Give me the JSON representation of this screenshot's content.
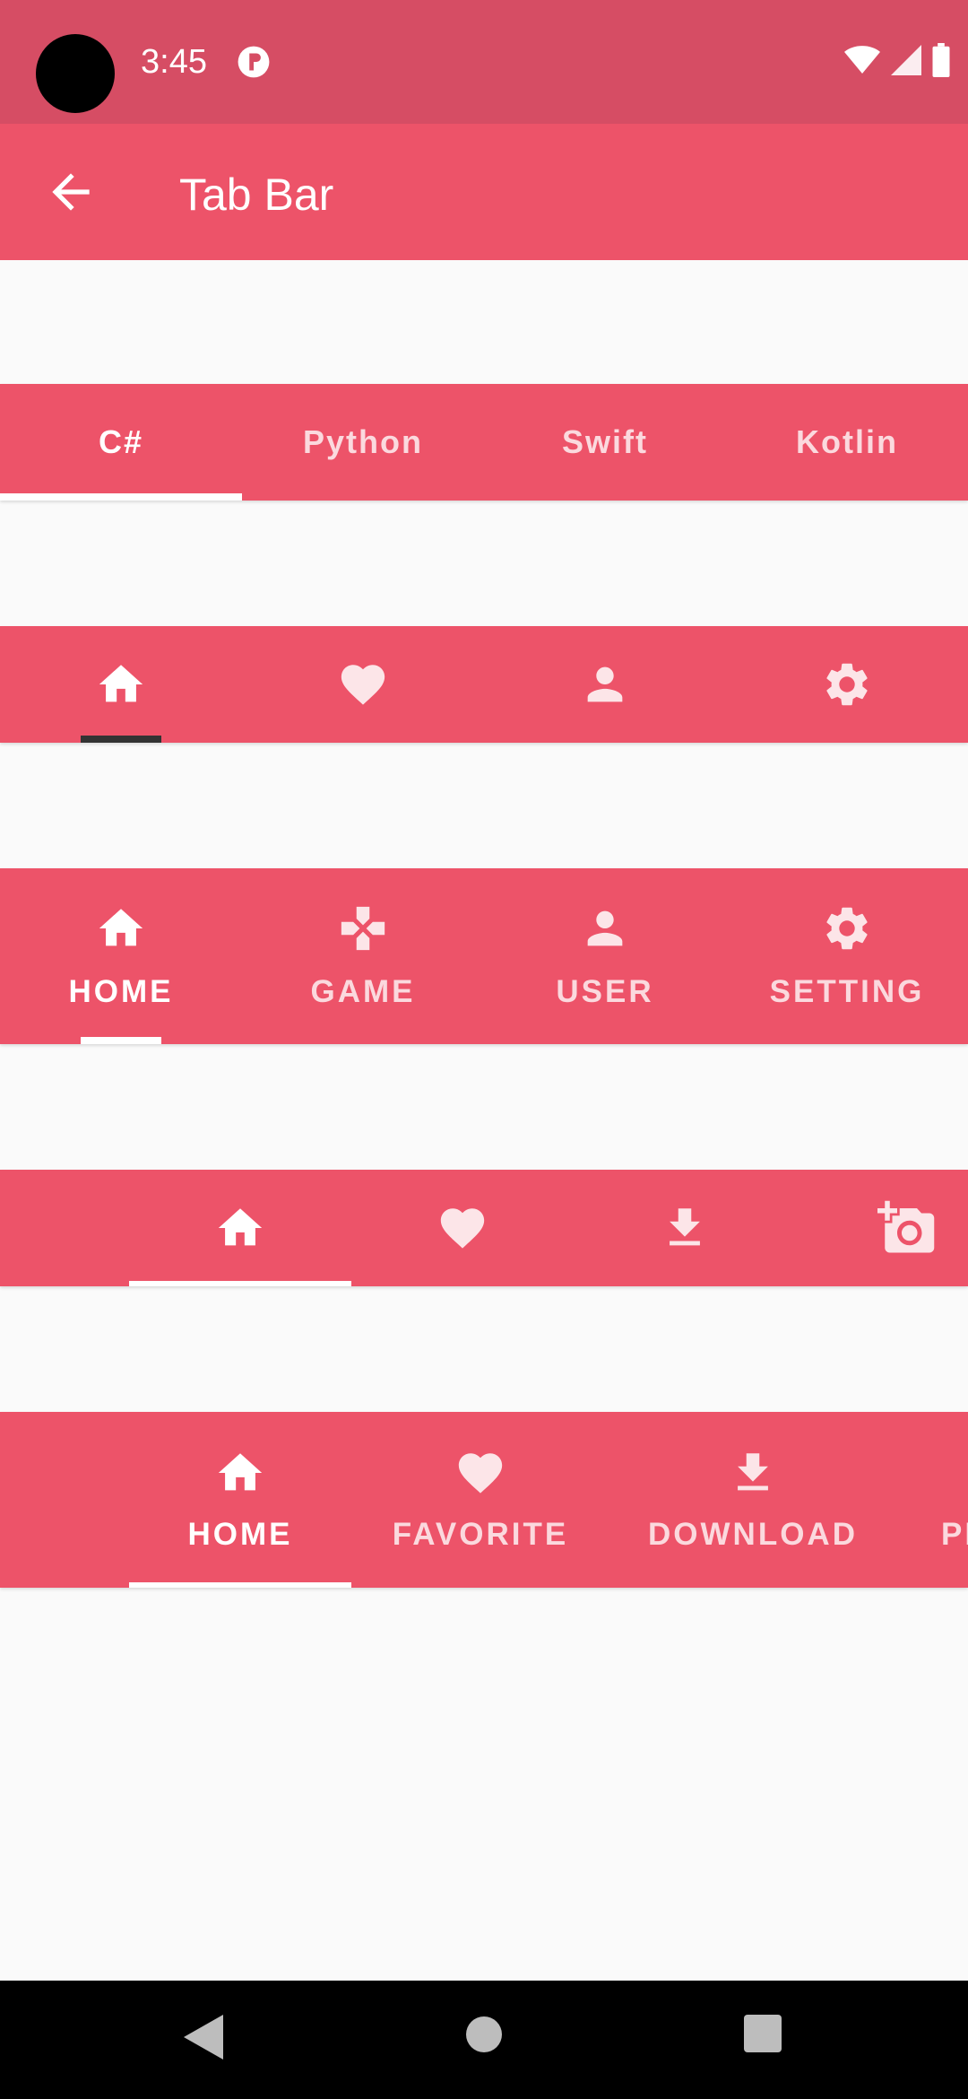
{
  "status_bar": {
    "time": "3:45"
  },
  "app_bar": {
    "title": "Tab Bar"
  },
  "tab_bars": [
    {
      "type": "text",
      "tabs": [
        "C#",
        "Python",
        "Swift",
        "Kotlin"
      ],
      "selected": 0
    },
    {
      "type": "icon",
      "icons": [
        "home-icon",
        "heart-icon",
        "person-icon",
        "gear-icon"
      ],
      "selected": 0
    },
    {
      "type": "icon+text",
      "tabs": [
        "HOME",
        "GAME",
        "USER",
        "SETTING"
      ],
      "icons": [
        "home-icon",
        "gamepad-icon",
        "person-icon",
        "gear-icon"
      ],
      "selected": 0
    },
    {
      "type": "icon-scrollable",
      "icons": [
        "home-icon",
        "heart-icon",
        "download-icon",
        "add-a-photo-icon"
      ],
      "selected": 0
    },
    {
      "type": "icon+text-scrollable",
      "tabs": [
        "HOME",
        "FAVORITE",
        "DOWNLOAD",
        "PH"
      ],
      "icons": [
        "home-icon",
        "heart-icon",
        "download-icon"
      ],
      "selected": 0
    }
  ],
  "colors": {
    "primary": "#ed5369",
    "status_bar": "#d64d64",
    "background": "#fafafa",
    "indicator_white": "#ffffff",
    "indicator_dark": "#333333"
  }
}
